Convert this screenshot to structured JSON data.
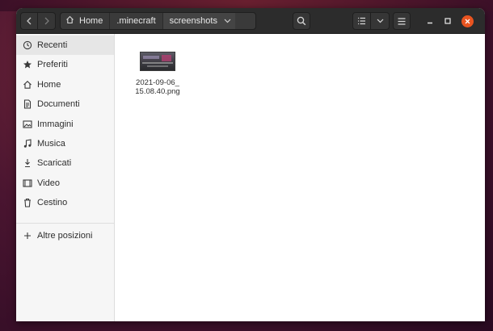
{
  "titlebar": {
    "nav_back_icon": "chevron-left-icon",
    "nav_forward_icon": "chevron-right-icon",
    "breadcrumbs": [
      "Home",
      ".minecraft",
      "screenshots"
    ],
    "search_icon": "search-icon",
    "view_list_icon": "list-view-icon",
    "view_options_icon": "chevron-down-icon",
    "menu_icon": "hamburger-menu-icon",
    "window_controls": [
      "minimize",
      "maximize",
      "close"
    ],
    "close_color": "#e95420"
  },
  "sidebar": {
    "items": [
      {
        "label": "Recenti",
        "icon": "clock-icon",
        "active": true
      },
      {
        "label": "Preferiti",
        "icon": "star-icon"
      },
      {
        "label": "Home",
        "icon": "home-icon"
      },
      {
        "label": "Documenti",
        "icon": "document-icon"
      },
      {
        "label": "Immagini",
        "icon": "image-icon"
      },
      {
        "label": "Musica",
        "icon": "music-icon"
      },
      {
        "label": "Scaricati",
        "icon": "download-icon"
      },
      {
        "label": "Video",
        "icon": "video-icon"
      },
      {
        "label": "Cestino",
        "icon": "trash-icon"
      }
    ],
    "other_locations": {
      "label": "Altre posizioni",
      "icon": "plus-icon"
    }
  },
  "content": {
    "files": [
      {
        "name": "2021-09-06_15.08.40.png",
        "type": "image"
      }
    ]
  }
}
